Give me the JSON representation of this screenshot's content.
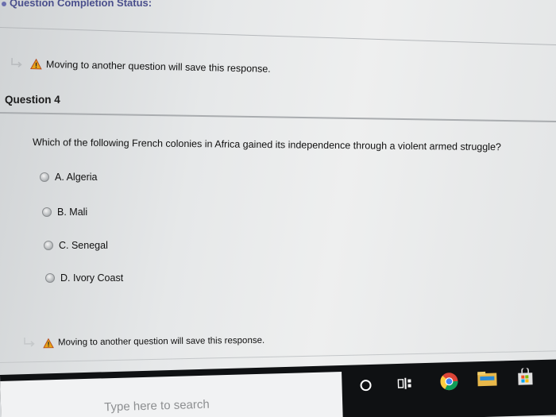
{
  "status": {
    "title": "Question Completion Status:"
  },
  "notice": {
    "text": "Moving to another question will save this response."
  },
  "question": {
    "header": "Question 4",
    "text": "Which of the following French colonies in Africa gained its independence through a violent armed struggle?",
    "options": [
      {
        "label": "A. Algeria"
      },
      {
        "label": "B. Mali"
      },
      {
        "label": "C. Senegal"
      },
      {
        "label": "D. Ivory Coast"
      }
    ]
  },
  "footer_notice": {
    "text": "Moving to another question will save this response."
  },
  "taskbar": {
    "search_placeholder": "Type here to search",
    "icons": [
      "cortana-icon",
      "task-view-icon",
      "chrome-icon",
      "file-explorer-icon",
      "store-icon"
    ]
  },
  "colors": {
    "status_title": "#4a4f8c",
    "warning": "#e8a317",
    "taskbar": "#0f1113"
  }
}
